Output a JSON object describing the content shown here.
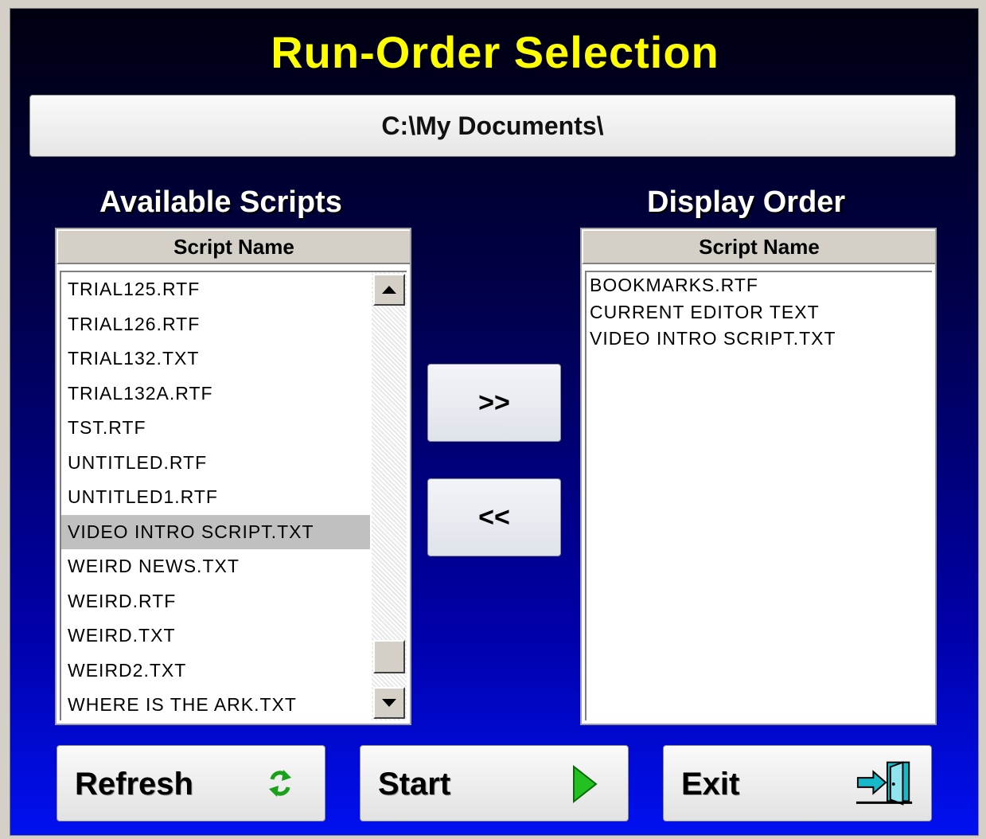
{
  "title": "Run-Order Selection",
  "path": "C:\\My Documents\\",
  "available": {
    "heading": "Available Scripts",
    "column_header": "Script Name",
    "items": [
      "TRIAL125.RTF",
      "TRIAL126.RTF",
      "TRIAL132.TXT",
      "TRIAL132A.RTF",
      "TST.RTF",
      "UNTITLED.RTF",
      "UNTITLED1.RTF",
      "VIDEO INTRO SCRIPT.TXT",
      "WEIRD NEWS.TXT",
      "WEIRD.RTF",
      "WEIRD.TXT",
      "WEIRD2.TXT",
      "WHERE IS THE ARK.TXT"
    ],
    "selected_item": "VIDEO INTRO SCRIPT.TXT"
  },
  "display_order": {
    "heading": "Display Order",
    "column_header": "Script Name",
    "items": [
      "BOOKMARKS.RTF",
      "CURRENT EDITOR TEXT",
      "VIDEO INTRO SCRIPT.TXT"
    ]
  },
  "buttons": {
    "add_label": ">>",
    "remove_label": "<<",
    "refresh_label": "Refresh",
    "start_label": "Start",
    "exit_label": "Exit"
  },
  "icons": {
    "refresh": "refresh-icon",
    "start": "play-icon",
    "exit": "exit-door-icon"
  },
  "colors": {
    "title": "#ffff00",
    "refresh_icon": "#1aa11a",
    "start_icon": "#22c020",
    "exit_icon": "#17b8c8"
  }
}
